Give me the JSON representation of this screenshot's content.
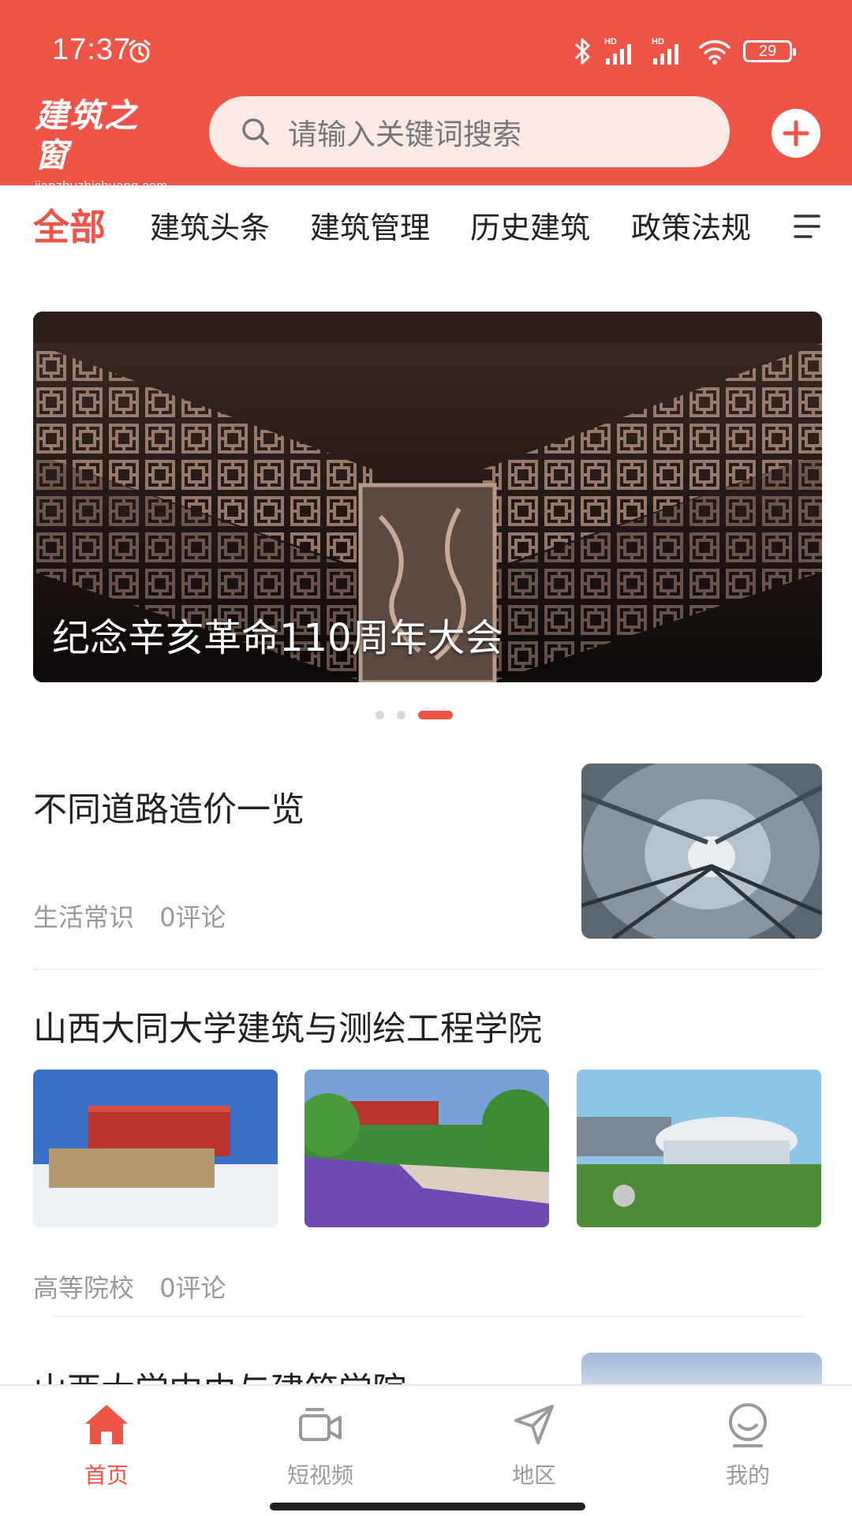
{
  "status_bar": {
    "time": "17:37",
    "battery": "29",
    "icons": [
      "alarm-icon",
      "bluetooth-icon",
      "signal-hd-icon",
      "signal-hd-icon",
      "wifi-icon",
      "battery-icon"
    ]
  },
  "header": {
    "logo_text": "建筑之窗",
    "logo_url": "jianzhuzhichuang.com",
    "search_placeholder": "请输入关键词搜索",
    "search_icon": "search-icon",
    "add_icon": "plus-circle-icon"
  },
  "tabs": [
    {
      "label": "全部",
      "active": true
    },
    {
      "label": "建筑头条",
      "active": false
    },
    {
      "label": "建筑管理",
      "active": false
    },
    {
      "label": "历史建筑",
      "active": false
    },
    {
      "label": "政策法规",
      "active": false
    }
  ],
  "banner": {
    "title": "纪念辛亥革命110周年大会",
    "page_count": 3,
    "active_page": 3
  },
  "articles": [
    {
      "title": "不同道路造价一览",
      "category": "生活常识",
      "comments": "0评论"
    },
    {
      "title": "山西大同大学建筑与测绘工程学院",
      "category": "高等院校",
      "comments": "0评论"
    },
    {
      "title": "山西大学中由与建筑学院"
    }
  ],
  "bottom_nav": [
    {
      "label": "首页",
      "icon": "home-icon",
      "active": true
    },
    {
      "label": "短视频",
      "icon": "video-camera-icon",
      "active": false
    },
    {
      "label": "地区",
      "icon": "location-arrow-icon",
      "active": false
    },
    {
      "label": "我的",
      "icon": "profile-smile-icon",
      "active": false
    }
  ],
  "colors": {
    "accent": "#ef5449",
    "muted": "#999999"
  }
}
